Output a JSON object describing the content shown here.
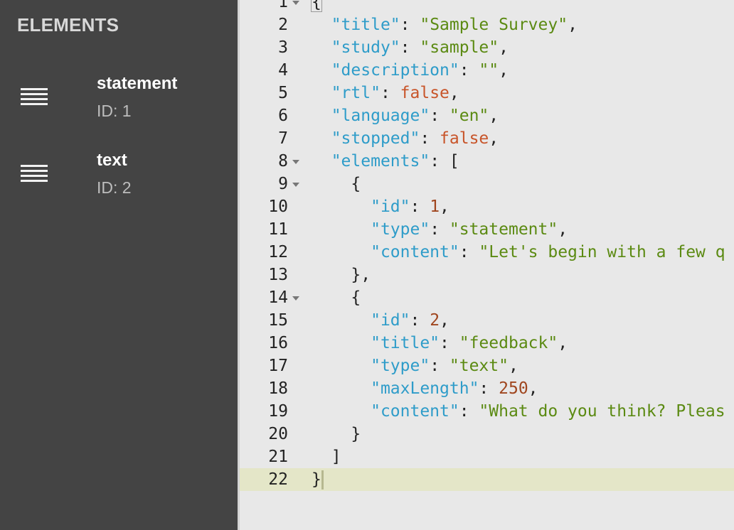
{
  "sidebar": {
    "title": "ELEMENTS",
    "items": [
      {
        "name": "statement",
        "id_label": "ID: 1"
      },
      {
        "name": "text",
        "id_label": "ID: 2"
      }
    ]
  },
  "editor": {
    "active_line": 22,
    "lines": [
      [
        {
          "t": "p",
          "v": "{"
        }
      ],
      [
        {
          "t": "p",
          "v": "  "
        },
        {
          "t": "k",
          "v": "\"title\""
        },
        {
          "t": "p",
          "v": ": "
        },
        {
          "t": "s",
          "v": "\"Sample Survey\""
        },
        {
          "t": "p",
          "v": ","
        }
      ],
      [
        {
          "t": "p",
          "v": "  "
        },
        {
          "t": "k",
          "v": "\"study\""
        },
        {
          "t": "p",
          "v": ": "
        },
        {
          "t": "s",
          "v": "\"sample\""
        },
        {
          "t": "p",
          "v": ","
        }
      ],
      [
        {
          "t": "p",
          "v": "  "
        },
        {
          "t": "k",
          "v": "\"description\""
        },
        {
          "t": "p",
          "v": ": "
        },
        {
          "t": "s",
          "v": "\"\""
        },
        {
          "t": "p",
          "v": ","
        }
      ],
      [
        {
          "t": "p",
          "v": "  "
        },
        {
          "t": "k",
          "v": "\"rtl\""
        },
        {
          "t": "p",
          "v": ": "
        },
        {
          "t": "b",
          "v": "false"
        },
        {
          "t": "p",
          "v": ","
        }
      ],
      [
        {
          "t": "p",
          "v": "  "
        },
        {
          "t": "k",
          "v": "\"language\""
        },
        {
          "t": "p",
          "v": ": "
        },
        {
          "t": "s",
          "v": "\"en\""
        },
        {
          "t": "p",
          "v": ","
        }
      ],
      [
        {
          "t": "p",
          "v": "  "
        },
        {
          "t": "k",
          "v": "\"stopped\""
        },
        {
          "t": "p",
          "v": ": "
        },
        {
          "t": "b",
          "v": "false"
        },
        {
          "t": "p",
          "v": ","
        }
      ],
      [
        {
          "t": "p",
          "v": "  "
        },
        {
          "t": "k",
          "v": "\"elements\""
        },
        {
          "t": "p",
          "v": ": ["
        }
      ],
      [
        {
          "t": "p",
          "v": "    {"
        }
      ],
      [
        {
          "t": "p",
          "v": "      "
        },
        {
          "t": "k",
          "v": "\"id\""
        },
        {
          "t": "p",
          "v": ": "
        },
        {
          "t": "n",
          "v": "1"
        },
        {
          "t": "p",
          "v": ","
        }
      ],
      [
        {
          "t": "p",
          "v": "      "
        },
        {
          "t": "k",
          "v": "\"type\""
        },
        {
          "t": "p",
          "v": ": "
        },
        {
          "t": "s",
          "v": "\"statement\""
        },
        {
          "t": "p",
          "v": ","
        }
      ],
      [
        {
          "t": "p",
          "v": "      "
        },
        {
          "t": "k",
          "v": "\"content\""
        },
        {
          "t": "p",
          "v": ": "
        },
        {
          "t": "s",
          "v": "\"Let's begin with a few q"
        }
      ],
      [
        {
          "t": "p",
          "v": "    },"
        }
      ],
      [
        {
          "t": "p",
          "v": "    {"
        }
      ],
      [
        {
          "t": "p",
          "v": "      "
        },
        {
          "t": "k",
          "v": "\"id\""
        },
        {
          "t": "p",
          "v": ": "
        },
        {
          "t": "n",
          "v": "2"
        },
        {
          "t": "p",
          "v": ","
        }
      ],
      [
        {
          "t": "p",
          "v": "      "
        },
        {
          "t": "k",
          "v": "\"title\""
        },
        {
          "t": "p",
          "v": ": "
        },
        {
          "t": "s",
          "v": "\"feedback\""
        },
        {
          "t": "p",
          "v": ","
        }
      ],
      [
        {
          "t": "p",
          "v": "      "
        },
        {
          "t": "k",
          "v": "\"type\""
        },
        {
          "t": "p",
          "v": ": "
        },
        {
          "t": "s",
          "v": "\"text\""
        },
        {
          "t": "p",
          "v": ","
        }
      ],
      [
        {
          "t": "p",
          "v": "      "
        },
        {
          "t": "k",
          "v": "\"maxLength\""
        },
        {
          "t": "p",
          "v": ": "
        },
        {
          "t": "n",
          "v": "250"
        },
        {
          "t": "p",
          "v": ","
        }
      ],
      [
        {
          "t": "p",
          "v": "      "
        },
        {
          "t": "k",
          "v": "\"content\""
        },
        {
          "t": "p",
          "v": ": "
        },
        {
          "t": "s",
          "v": "\"What do you think? Pleas"
        }
      ],
      [
        {
          "t": "p",
          "v": "    }"
        }
      ],
      [
        {
          "t": "p",
          "v": "  ]"
        }
      ],
      [
        {
          "t": "p",
          "v": "}"
        }
      ]
    ],
    "fold_lines": [
      1,
      8,
      9,
      14
    ]
  },
  "colors": {
    "sidebar_bg": "#444444",
    "editor_bg": "#e8e8e8",
    "key": "#2e9cc9",
    "string": "#5b8a12",
    "boolean": "#c8552a",
    "number": "#a0461f",
    "active_line_bg": "#e4e6c8"
  },
  "icons": {
    "element_item": "list-lines-icon",
    "fold": "fold-arrow-icon"
  }
}
